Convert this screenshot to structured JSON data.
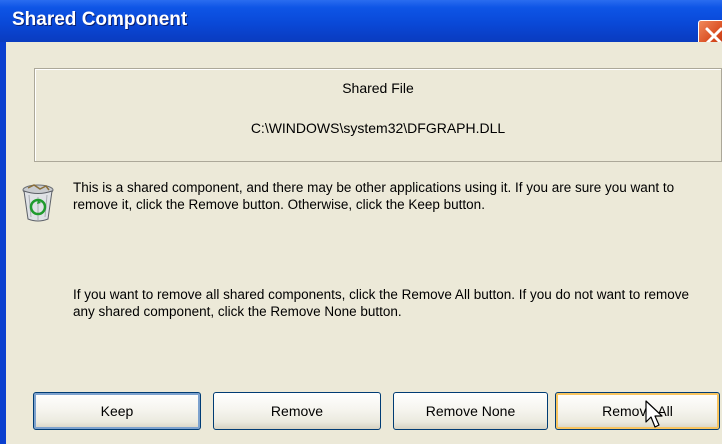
{
  "window": {
    "title": "Shared Component"
  },
  "file_group": {
    "heading": "Shared File",
    "path": "C:\\WINDOWS\\system32\\DFGRAPH.DLL"
  },
  "messages": {
    "info": "This is a shared component, and there may be other applications using it.  If you are sure you want to remove it, click the Remove button.  Otherwise, click the Keep button.",
    "all": "If you want to remove all shared components, click the Remove All button.  If you do not want to remove any shared component, click the Remove None button."
  },
  "buttons": {
    "keep": "Keep",
    "remove": "Remove",
    "remove_none": "Remove None",
    "remove_all": "Remove All"
  },
  "icons": {
    "recycle_bin": "recycle-bin-icon",
    "close": "close-icon",
    "cursor": "mouse-pointer-icon"
  },
  "colors": {
    "titlebar": "#0a49d8",
    "close_button": "#d94c20",
    "dialog_face": "#ece9d8",
    "button_border": "#003c74",
    "hover_highlight": "#f8c560"
  }
}
